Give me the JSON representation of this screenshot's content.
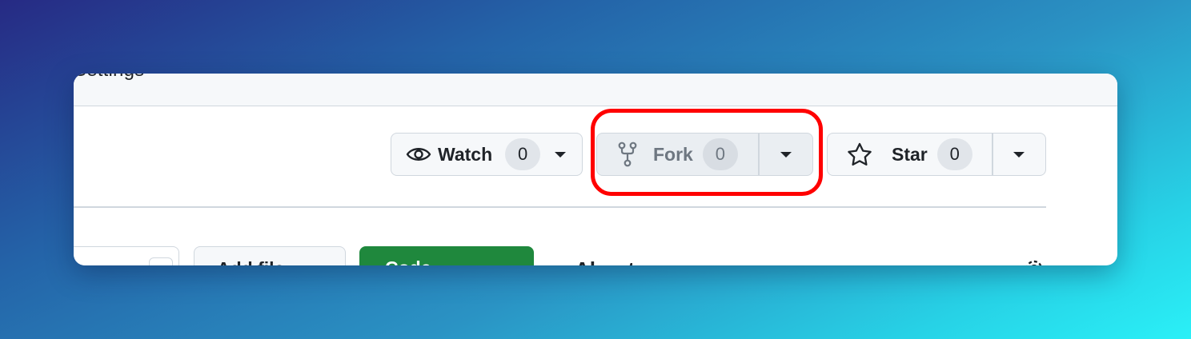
{
  "header": {
    "partial_nav_text": "Settings"
  },
  "actions": {
    "watch": {
      "label": "Watch",
      "count": "0",
      "icon": "eye-icon"
    },
    "fork": {
      "label": "Fork",
      "count": "0",
      "icon": "repo-forked-icon"
    },
    "star": {
      "label": "Star",
      "count": "0",
      "icon": "star-icon"
    }
  },
  "content": {
    "add_file_label": "Add file",
    "code_label": "Code",
    "about_heading": "About"
  },
  "colors": {
    "highlight": "#ff0000",
    "code_button": "#1f883d",
    "button_bg": "#f6f8fa",
    "border": "#d0d7de"
  }
}
